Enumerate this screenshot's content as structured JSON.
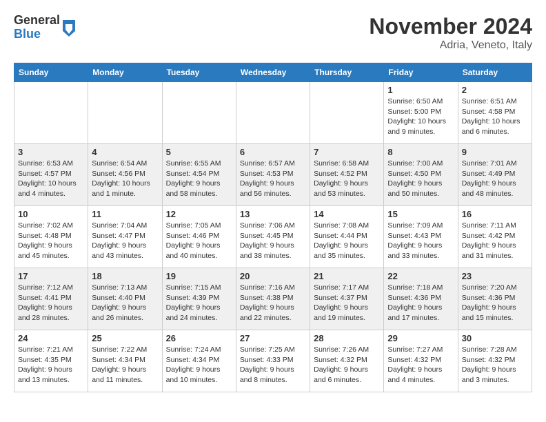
{
  "header": {
    "logo_general": "General",
    "logo_blue": "Blue",
    "month": "November 2024",
    "location": "Adria, Veneto, Italy"
  },
  "weekdays": [
    "Sunday",
    "Monday",
    "Tuesday",
    "Wednesday",
    "Thursday",
    "Friday",
    "Saturday"
  ],
  "weeks": [
    [
      {
        "day": "",
        "info": ""
      },
      {
        "day": "",
        "info": ""
      },
      {
        "day": "",
        "info": ""
      },
      {
        "day": "",
        "info": ""
      },
      {
        "day": "",
        "info": ""
      },
      {
        "day": "1",
        "info": "Sunrise: 6:50 AM\nSunset: 5:00 PM\nDaylight: 10 hours and 9 minutes."
      },
      {
        "day": "2",
        "info": "Sunrise: 6:51 AM\nSunset: 4:58 PM\nDaylight: 10 hours and 6 minutes."
      }
    ],
    [
      {
        "day": "3",
        "info": "Sunrise: 6:53 AM\nSunset: 4:57 PM\nDaylight: 10 hours and 4 minutes."
      },
      {
        "day": "4",
        "info": "Sunrise: 6:54 AM\nSunset: 4:56 PM\nDaylight: 10 hours and 1 minute."
      },
      {
        "day": "5",
        "info": "Sunrise: 6:55 AM\nSunset: 4:54 PM\nDaylight: 9 hours and 58 minutes."
      },
      {
        "day": "6",
        "info": "Sunrise: 6:57 AM\nSunset: 4:53 PM\nDaylight: 9 hours and 56 minutes."
      },
      {
        "day": "7",
        "info": "Sunrise: 6:58 AM\nSunset: 4:52 PM\nDaylight: 9 hours and 53 minutes."
      },
      {
        "day": "8",
        "info": "Sunrise: 7:00 AM\nSunset: 4:50 PM\nDaylight: 9 hours and 50 minutes."
      },
      {
        "day": "9",
        "info": "Sunrise: 7:01 AM\nSunset: 4:49 PM\nDaylight: 9 hours and 48 minutes."
      }
    ],
    [
      {
        "day": "10",
        "info": "Sunrise: 7:02 AM\nSunset: 4:48 PM\nDaylight: 9 hours and 45 minutes."
      },
      {
        "day": "11",
        "info": "Sunrise: 7:04 AM\nSunset: 4:47 PM\nDaylight: 9 hours and 43 minutes."
      },
      {
        "day": "12",
        "info": "Sunrise: 7:05 AM\nSunset: 4:46 PM\nDaylight: 9 hours and 40 minutes."
      },
      {
        "day": "13",
        "info": "Sunrise: 7:06 AM\nSunset: 4:45 PM\nDaylight: 9 hours and 38 minutes."
      },
      {
        "day": "14",
        "info": "Sunrise: 7:08 AM\nSunset: 4:44 PM\nDaylight: 9 hours and 35 minutes."
      },
      {
        "day": "15",
        "info": "Sunrise: 7:09 AM\nSunset: 4:43 PM\nDaylight: 9 hours and 33 minutes."
      },
      {
        "day": "16",
        "info": "Sunrise: 7:11 AM\nSunset: 4:42 PM\nDaylight: 9 hours and 31 minutes."
      }
    ],
    [
      {
        "day": "17",
        "info": "Sunrise: 7:12 AM\nSunset: 4:41 PM\nDaylight: 9 hours and 28 minutes."
      },
      {
        "day": "18",
        "info": "Sunrise: 7:13 AM\nSunset: 4:40 PM\nDaylight: 9 hours and 26 minutes."
      },
      {
        "day": "19",
        "info": "Sunrise: 7:15 AM\nSunset: 4:39 PM\nDaylight: 9 hours and 24 minutes."
      },
      {
        "day": "20",
        "info": "Sunrise: 7:16 AM\nSunset: 4:38 PM\nDaylight: 9 hours and 22 minutes."
      },
      {
        "day": "21",
        "info": "Sunrise: 7:17 AM\nSunset: 4:37 PM\nDaylight: 9 hours and 19 minutes."
      },
      {
        "day": "22",
        "info": "Sunrise: 7:18 AM\nSunset: 4:36 PM\nDaylight: 9 hours and 17 minutes."
      },
      {
        "day": "23",
        "info": "Sunrise: 7:20 AM\nSunset: 4:36 PM\nDaylight: 9 hours and 15 minutes."
      }
    ],
    [
      {
        "day": "24",
        "info": "Sunrise: 7:21 AM\nSunset: 4:35 PM\nDaylight: 9 hours and 13 minutes."
      },
      {
        "day": "25",
        "info": "Sunrise: 7:22 AM\nSunset: 4:34 PM\nDaylight: 9 hours and 11 minutes."
      },
      {
        "day": "26",
        "info": "Sunrise: 7:24 AM\nSunset: 4:34 PM\nDaylight: 9 hours and 10 minutes."
      },
      {
        "day": "27",
        "info": "Sunrise: 7:25 AM\nSunset: 4:33 PM\nDaylight: 9 hours and 8 minutes."
      },
      {
        "day": "28",
        "info": "Sunrise: 7:26 AM\nSunset: 4:32 PM\nDaylight: 9 hours and 6 minutes."
      },
      {
        "day": "29",
        "info": "Sunrise: 7:27 AM\nSunset: 4:32 PM\nDaylight: 9 hours and 4 minutes."
      },
      {
        "day": "30",
        "info": "Sunrise: 7:28 AM\nSunset: 4:32 PM\nDaylight: 9 hours and 3 minutes."
      }
    ]
  ]
}
